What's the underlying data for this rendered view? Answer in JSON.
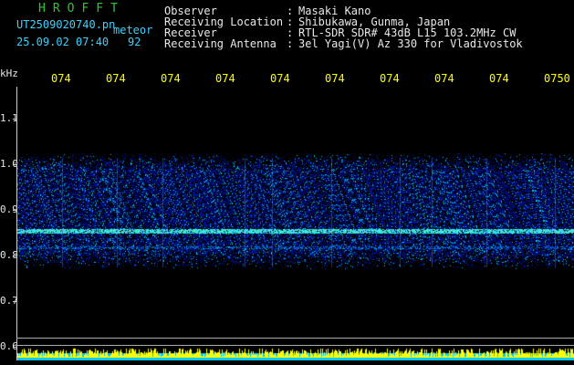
{
  "header": {
    "brand": "HROFFT",
    "filename": "UT2509020740.pn",
    "tag": "meteor",
    "datetime": "25.09.02 07:40",
    "count": "92",
    "fields": [
      {
        "label": "Observer",
        "value": "Masaki Kano"
      },
      {
        "label": "Receiving Location",
        "value": "Shibukawa, Gunma, Japan"
      },
      {
        "label": "Receiver",
        "value": "RTL-SDR SDR# 43dB L15 103.2MHz CW"
      },
      {
        "label": "Receiving Antenna",
        "value": "3el Yagi(V) Az 330 for Vladivostok"
      }
    ]
  },
  "axis": {
    "unit": "kHz",
    "time_ticks": [
      "074",
      "074",
      "074",
      "074",
      "074",
      "074",
      "074",
      "074",
      "074",
      "0750"
    ],
    "freq_ticks": [
      "1.1",
      "1.0",
      "0.9",
      "0.8",
      "0.7",
      "0.6"
    ]
  },
  "colors": {
    "background": "#000000",
    "title": "#2ec82e",
    "filename": "#3fd0ff",
    "ticks": "#ffff00",
    "signal": "#2040ff",
    "carrier": "#40ffd0",
    "bottom_bars": "#ffff00",
    "bottom_base": "#00c8ff"
  }
}
